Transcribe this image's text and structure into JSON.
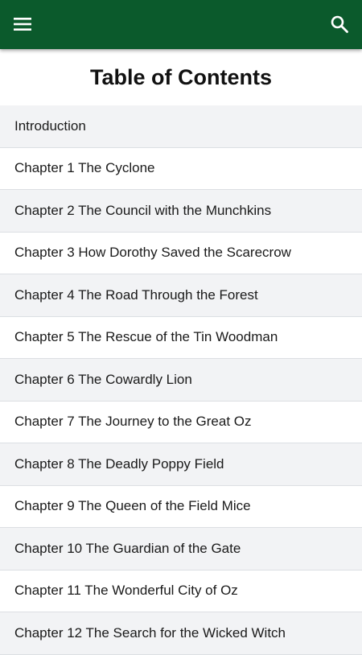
{
  "app_bar": {
    "background_color": "#0b5a2c",
    "menu_icon": "hamburger-menu-icon",
    "search_icon": "search-icon"
  },
  "page": {
    "title": "Table of Contents"
  },
  "toc": {
    "items": [
      {
        "label": "Introduction"
      },
      {
        "label": "Chapter 1 The Cyclone"
      },
      {
        "label": "Chapter 2 The Council with the Munchkins"
      },
      {
        "label": "Chapter 3 How Dorothy Saved the Scarecrow"
      },
      {
        "label": "Chapter 4 The Road Through the Forest"
      },
      {
        "label": "Chapter 5 The Rescue of the Tin Woodman"
      },
      {
        "label": "Chapter 6 The Cowardly Lion"
      },
      {
        "label": "Chapter 7 The Journey to the Great Oz"
      },
      {
        "label": "Chapter 8 The Deadly Poppy Field"
      },
      {
        "label": "Chapter 9 The Queen of the Field Mice"
      },
      {
        "label": "Chapter 10 The Guardian of the Gate"
      },
      {
        "label": "Chapter 11 The Wonderful City of Oz"
      },
      {
        "label": "Chapter 12 The Search for the Wicked Witch"
      }
    ]
  }
}
